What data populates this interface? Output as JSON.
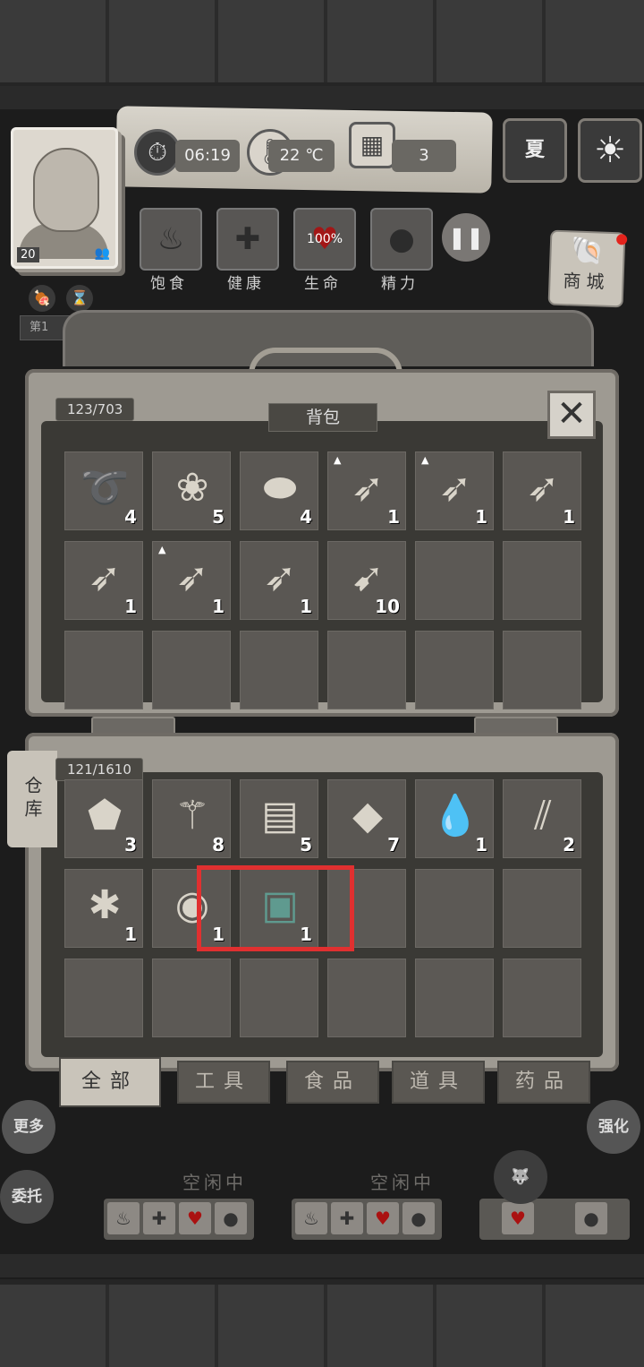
{
  "hud": {
    "time": "06:19",
    "temperature": "22 ℃",
    "day": "3",
    "season": "夏",
    "level": "20",
    "needs": [
      {
        "label": "饱食",
        "icon": "stomach-icon",
        "value": ""
      },
      {
        "label": "健康",
        "icon": "plus-icon",
        "value": ""
      },
      {
        "label": "生命",
        "icon": "heart-icon",
        "value": "100%"
      },
      {
        "label": "精力",
        "icon": "person-icon",
        "value": ""
      }
    ],
    "shop_label": "商城",
    "day_tag": "第1"
  },
  "backpack": {
    "title": "背包",
    "capacity": "123/703",
    "items": [
      {
        "icon": "rope-icon",
        "qty": "4",
        "upgrade": false
      },
      {
        "icon": "berries-icon",
        "qty": "5",
        "upgrade": false
      },
      {
        "icon": "bread-icon",
        "qty": "4",
        "upgrade": false
      },
      {
        "icon": "spear-icon",
        "qty": "1",
        "upgrade": true
      },
      {
        "icon": "spear-icon",
        "qty": "1",
        "upgrade": true
      },
      {
        "icon": "spear-icon",
        "qty": "1",
        "upgrade": false
      },
      {
        "icon": "spear-icon",
        "qty": "1",
        "upgrade": false
      },
      {
        "icon": "spear-icon",
        "qty": "1",
        "upgrade": true
      },
      {
        "icon": "spear-icon",
        "qty": "1",
        "upgrade": false
      },
      {
        "icon": "arrows-icon",
        "qty": "10",
        "upgrade": false
      }
    ],
    "total_slots": 18
  },
  "warehouse": {
    "tab_label": "仓库",
    "capacity": "121/1610",
    "items": [
      {
        "icon": "stone-icon",
        "qty": "3"
      },
      {
        "icon": "branches-icon",
        "qty": "8"
      },
      {
        "icon": "planks-icon",
        "qty": "5"
      },
      {
        "icon": "flint-icon",
        "qty": "7"
      },
      {
        "icon": "water-puddle-icon",
        "qty": "1"
      },
      {
        "icon": "sticks-icon",
        "qty": "2"
      },
      {
        "icon": "animal-hide-icon",
        "qty": "1"
      },
      {
        "icon": "seeds-bowl-icon",
        "qty": "1"
      },
      {
        "icon": "treasure-chest-icon",
        "qty": "1"
      }
    ],
    "total_slots": 18
  },
  "categories": [
    {
      "label": "全部",
      "active": true
    },
    {
      "label": "工具",
      "active": false
    },
    {
      "label": "食品",
      "active": false
    },
    {
      "label": "道具",
      "active": false
    },
    {
      "label": "药品",
      "active": false
    }
  ],
  "side": {
    "more": "更多",
    "delegate": "委托",
    "strengthen": "强化"
  },
  "workers": [
    {
      "status": "空闲中"
    },
    {
      "status": "空闲中"
    }
  ]
}
